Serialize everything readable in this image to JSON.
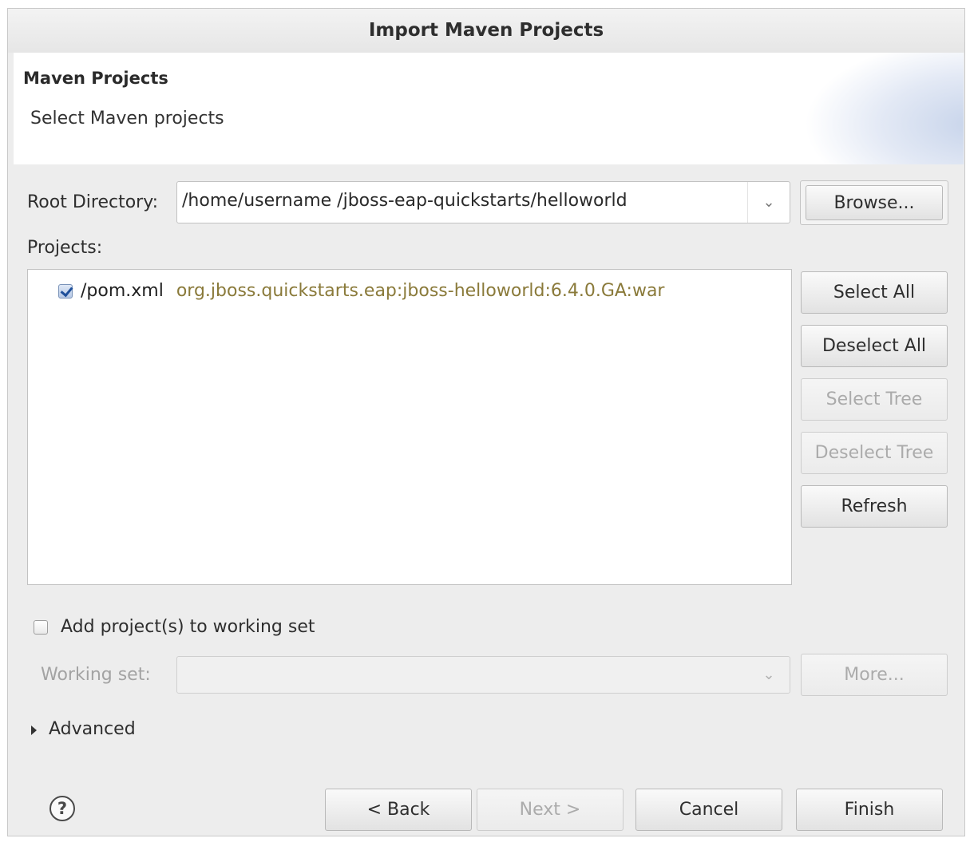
{
  "window": {
    "title": "Import Maven Projects"
  },
  "header": {
    "title": "Maven Projects",
    "description": "Select Maven projects"
  },
  "root_directory": {
    "label": "Root Directory:",
    "value": "/home/username /jboss-eap-quickstarts/helloworld",
    "browse_label": "Browse..."
  },
  "projects": {
    "label": "Projects:",
    "items": [
      {
        "checked": true,
        "file": "/pom.xml",
        "coordinates": "org.jboss.quickstarts.eap:jboss-helloworld:6.4.0.GA:war"
      }
    ]
  },
  "side_buttons": {
    "select_all": "Select All",
    "deselect_all": "Deselect All",
    "select_tree": "Select Tree",
    "deselect_tree": "Deselect Tree",
    "refresh": "Refresh"
  },
  "working_set": {
    "checkbox_label": "Add project(s) to working set",
    "checked": false,
    "label": "Working set:",
    "value": "",
    "more_label": "More..."
  },
  "advanced": {
    "label": "Advanced",
    "expanded": false
  },
  "footer": {
    "help_glyph": "?",
    "back": "< Back",
    "next": "Next >",
    "cancel": "Cancel",
    "finish": "Finish"
  },
  "icons": {
    "dropdown": "chevron-down-icon",
    "help": "help-icon",
    "expander": "triangle-right-icon",
    "checkbox_checked": "checkmark-icon"
  },
  "colors": {
    "dialog_bg": "#ededed",
    "coordinates_text": "#8a7a3a",
    "disabled_text": "#a3a3a3"
  }
}
